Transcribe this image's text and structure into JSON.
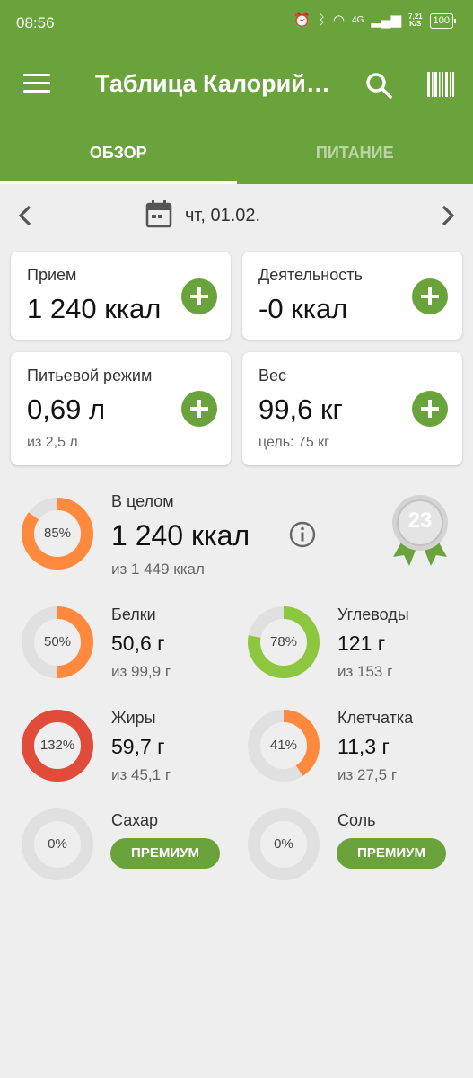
{
  "status_bar": {
    "time": "08:56",
    "network": "4G",
    "speed_value": "7,21",
    "speed_unit": "K/S",
    "battery": "100"
  },
  "app_bar": {
    "title": "Таблица Калорий…",
    "icons": [
      "menu-icon",
      "search-icon",
      "barcode-icon"
    ]
  },
  "tabs": [
    {
      "label": "ОБЗОР",
      "active": true
    },
    {
      "label": "ПИТАНИЕ",
      "active": false
    }
  ],
  "date": {
    "label": "чт, 01.02."
  },
  "cards": {
    "intake": {
      "label": "Прием",
      "value": "1 240 ккал"
    },
    "activity": {
      "label": "Деятельность",
      "value": "-0 ккал"
    },
    "water": {
      "label": "Питьевой режим",
      "value": "0,69 л",
      "sub": "из 2,5 л"
    },
    "weight": {
      "label": "Вес",
      "value": "99,6 кг",
      "sub": "цель: 75 кг"
    }
  },
  "overall": {
    "label": "В целом",
    "value": "1 240 ккал",
    "sub": "из 1 449 ккал",
    "percent_label": "85%",
    "percent": 85,
    "badge": "23"
  },
  "nutrients": {
    "protein": {
      "label": "Белки",
      "value": "50,6 г",
      "sub": "из 99,9 г",
      "percent_label": "50%",
      "percent": 50
    },
    "carbs": {
      "label": "Углеводы",
      "value": "121 г",
      "sub": "из 153 г",
      "percent_label": "78%",
      "percent": 78
    },
    "fat": {
      "label": "Жиры",
      "value": "59,7 г",
      "sub": "из 45,1 г",
      "percent_label": "132%",
      "percent": 132
    },
    "fiber": {
      "label": "Клетчатка",
      "value": "11,3 г",
      "sub": "из 27,5 г",
      "percent_label": "41%",
      "percent": 41
    },
    "sugar": {
      "label": "Сахар",
      "percent_label": "0%",
      "percent": 0,
      "premium": "ПРЕМИУМ"
    },
    "salt": {
      "label": "Соль",
      "percent_label": "0%",
      "percent": 0,
      "premium": "ПРЕМИУМ"
    }
  },
  "colors": {
    "brand": "#6aa33c",
    "orange": "#ff8a3d",
    "lime": "#8dc63f",
    "red": "#e04b3a",
    "track": "#e0e0e0"
  }
}
